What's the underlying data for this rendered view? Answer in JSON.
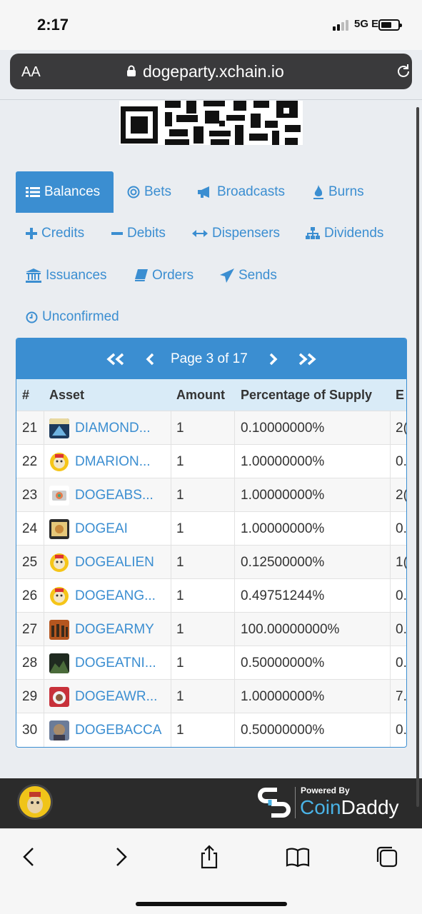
{
  "status_bar": {
    "time": "2:17",
    "network": "5G E"
  },
  "browser": {
    "text_size_label": "AA",
    "url": "dogeparty.xchain.io"
  },
  "nav": {
    "tabs": [
      {
        "label": "Balances",
        "icon": "list-icon",
        "active": true
      },
      {
        "label": "Bets",
        "icon": "target-icon"
      },
      {
        "label": "Broadcasts",
        "icon": "bullhorn-icon"
      },
      {
        "label": "Burns",
        "icon": "fire-icon"
      },
      {
        "label": "Credits",
        "icon": "plus-icon"
      },
      {
        "label": "Debits",
        "icon": "minus-icon"
      },
      {
        "label": "Dispensers",
        "icon": "arrows-horizontal-icon"
      },
      {
        "label": "Dividends",
        "icon": "sitemap-icon"
      },
      {
        "label": "Issuances",
        "icon": "bank-icon"
      },
      {
        "label": "Orders",
        "icon": "book-icon"
      },
      {
        "label": "Sends",
        "icon": "send-icon"
      },
      {
        "label": "Unconfirmed",
        "icon": "clock-icon"
      }
    ]
  },
  "pager": {
    "first": "<<",
    "prev": "<",
    "label": "Page 3 of 17",
    "next": ">",
    "last": ">>"
  },
  "table": {
    "headers": {
      "num": "#",
      "asset": "Asset",
      "amount": "Amount",
      "percentage": "Percentage of Supply",
      "extra": "E"
    },
    "rows": [
      {
        "num": "21",
        "asset": "DIAMOND...",
        "amount": "1",
        "percentage": "0.10000000%",
        "extra": "2("
      },
      {
        "num": "22",
        "asset": "DMARION...",
        "amount": "1",
        "percentage": "1.00000000%",
        "extra": "0."
      },
      {
        "num": "23",
        "asset": "DOGEABS...",
        "amount": "1",
        "percentage": "1.00000000%",
        "extra": "2("
      },
      {
        "num": "24",
        "asset": "DOGEAI",
        "amount": "1",
        "percentage": "1.00000000%",
        "extra": "0."
      },
      {
        "num": "25",
        "asset": "DOGEALIEN",
        "amount": "1",
        "percentage": "0.12500000%",
        "extra": "1("
      },
      {
        "num": "26",
        "asset": "DOGEANG...",
        "amount": "1",
        "percentage": "0.49751244%",
        "extra": "0."
      },
      {
        "num": "27",
        "asset": "DOGEARMY",
        "amount": "1",
        "percentage": "100.00000000%",
        "extra": "0."
      },
      {
        "num": "28",
        "asset": "DOGEATNI...",
        "amount": "1",
        "percentage": "0.50000000%",
        "extra": "0."
      },
      {
        "num": "29",
        "asset": "DOGEAWR...",
        "amount": "1",
        "percentage": "1.00000000%",
        "extra": "7."
      },
      {
        "num": "30",
        "asset": "DOGEBACCA",
        "amount": "1",
        "percentage": "0.50000000%",
        "extra": "0."
      }
    ]
  },
  "footer": {
    "powered_by": "Powered By",
    "brand_part1": "Coin",
    "brand_part2": "Daddy"
  },
  "colors": {
    "accent": "#3b8ed1",
    "header_bg": "#d9ebf7",
    "footer_bg": "#2b2b2b"
  }
}
